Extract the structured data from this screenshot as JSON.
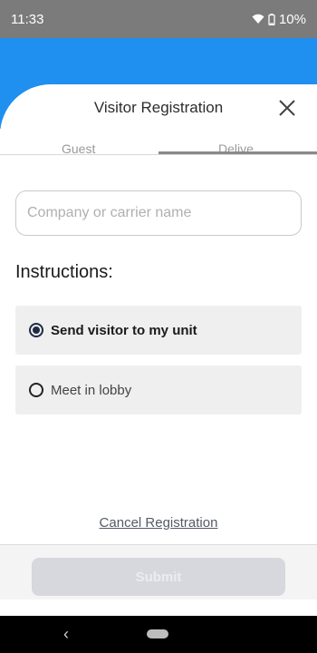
{
  "status_bar": {
    "time": "11:33",
    "battery": "10%"
  },
  "sheet": {
    "title": "Visitor Registration",
    "close_icon": "close-icon"
  },
  "tabs": [
    {
      "label": "Guest",
      "selected": false
    },
    {
      "label": "Delive",
      "selected": true
    }
  ],
  "form": {
    "company_placeholder": "Company or carrier name",
    "company_value": "",
    "instructions_label": "Instructions:",
    "options": [
      {
        "label": "Send visitor to my unit",
        "selected": true
      },
      {
        "label": "Meet in lobby",
        "selected": false
      }
    ]
  },
  "actions": {
    "cancel_label": "Cancel Registration",
    "submit_label": "Submit"
  },
  "nav": {
    "back_icon": "back-icon",
    "home_icon": "home-pill-icon"
  },
  "colors": {
    "header_blue": "#1f8ff0",
    "status_gray": "#7b7b7b",
    "option_bg": "#efefef",
    "submit_disabled": "#d7d8de"
  }
}
